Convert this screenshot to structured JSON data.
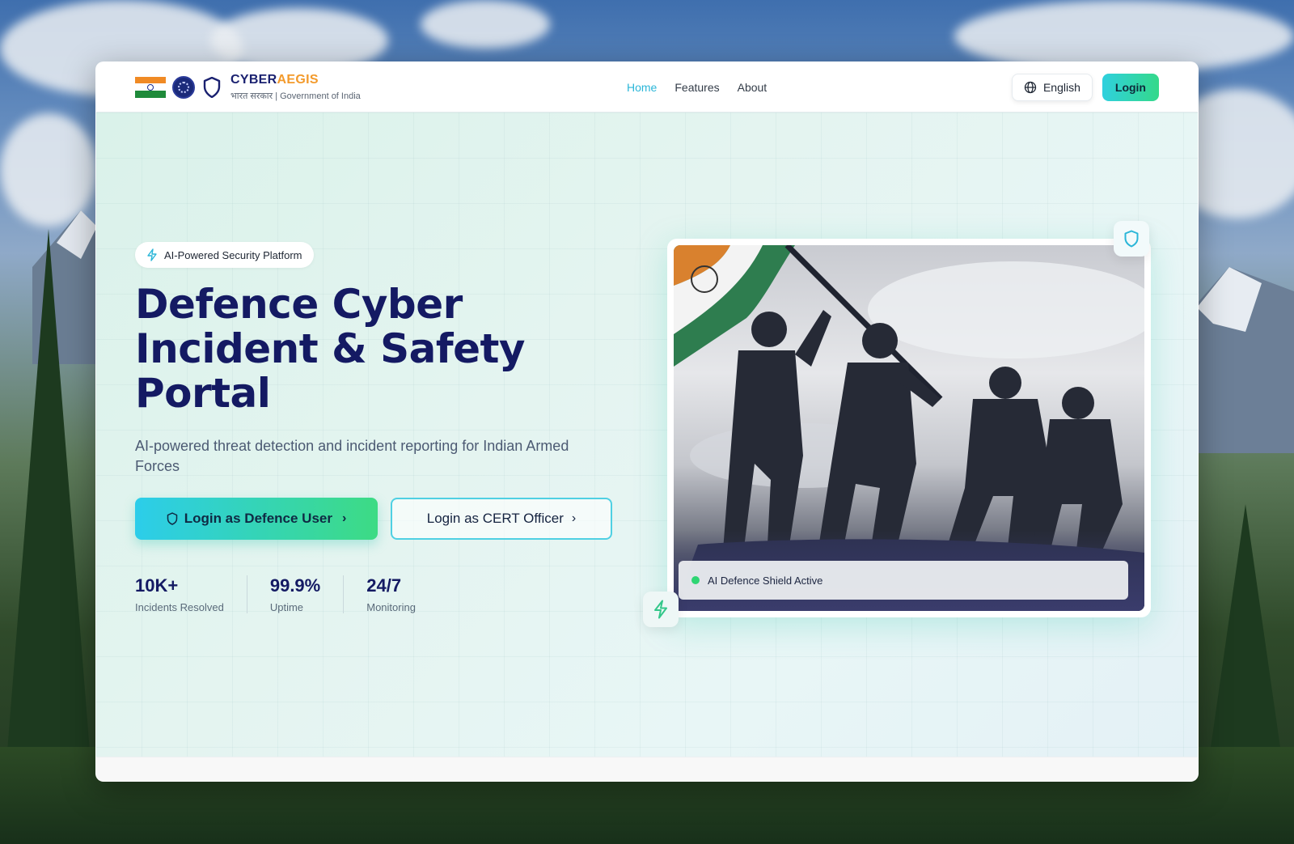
{
  "brand": {
    "name_primary": "CYBER",
    "name_accent": "AEGIS",
    "subtitle": "भारत सरकार | Government of India"
  },
  "nav": {
    "links": [
      {
        "label": "Home",
        "active": true
      },
      {
        "label": "Features",
        "active": false
      },
      {
        "label": "About",
        "active": false
      }
    ],
    "language_label": "English",
    "login_label": "Login"
  },
  "hero": {
    "badge": "AI-Powered Security Platform",
    "title_line1": "Defence Cyber",
    "title_line2": "Incident & Safety",
    "title_line3": "Portal",
    "subtitle": "AI-powered threat detection and incident reporting for Indian Armed Forces",
    "primary_button": "Login as Defence User",
    "secondary_button": "Login as CERT Officer",
    "stats": [
      {
        "value": "10K+",
        "label": "Incidents Resolved"
      },
      {
        "value": "99.9%",
        "label": "Uptime"
      },
      {
        "value": "24/7",
        "label": "Monitoring"
      }
    ]
  },
  "card": {
    "status_label": "AI Defence Shield Active"
  },
  "colors": {
    "accent_cyan": "#2bb6d8",
    "accent_green": "#34d98a",
    "brand_navy": "#141a63",
    "brand_orange": "#f39a2b",
    "status_green": "#2ed573"
  }
}
